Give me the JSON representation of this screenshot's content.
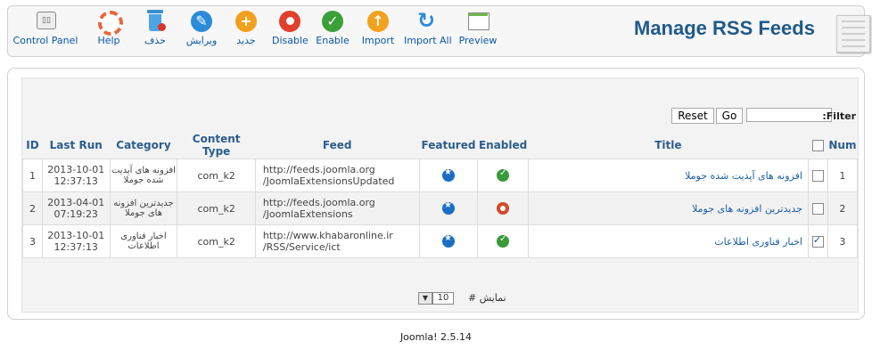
{
  "toolbar": {
    "buttons": [
      {
        "label": "Control Panel",
        "icon": "control-panel-icon"
      },
      {
        "label": "Help",
        "icon": "help-icon"
      },
      {
        "label": "حذف",
        "icon": "trash-icon"
      },
      {
        "label": "ویرایش",
        "icon": "edit-icon"
      },
      {
        "label": "جدید",
        "icon": "add-icon"
      },
      {
        "label": "Disable",
        "icon": "disable-icon"
      },
      {
        "label": "Enable",
        "icon": "enable-icon"
      },
      {
        "label": "Import",
        "icon": "import-icon"
      },
      {
        "label": "Import All",
        "icon": "import-all-icon"
      },
      {
        "label": "Preview",
        "icon": "preview-icon"
      }
    ]
  },
  "page_title": "Manage RSS Feeds",
  "filter": {
    "label": ":Filter",
    "value": "",
    "go_label": "Go",
    "reset_label": "Reset"
  },
  "table": {
    "headers": {
      "id": "ID",
      "last_run": "Last Run",
      "category": "Category",
      "content_type": "Content Type",
      "feed": "Feed",
      "featured": "Featured",
      "enabled": "Enabled",
      "title": "Title",
      "num": "Num"
    },
    "rows": [
      {
        "id": "1",
        "date": "2013-10-01",
        "time": "12:37:13",
        "category": "افزونه های آپدیت شده جوملا",
        "content_type": "com_k2",
        "feed1": "http://feeds.joomla.org",
        "feed2": "/JoomlaExtensionsUpdated",
        "featured": "yes",
        "enabled": "yes",
        "title": "افزونه های آپدیت شده جوملا",
        "checked": false,
        "num": "1"
      },
      {
        "id": "2",
        "date": "2013-04-01",
        "time": "07:19:23",
        "category": "جدیدترین افزونه های جوملا",
        "content_type": "com_k2",
        "feed1": "http://feeds.joomla.org",
        "feed2": "/JoomlaExtensions",
        "featured": "yes",
        "enabled": "no",
        "title": "جدیدترین افزونه های جوملا",
        "checked": false,
        "num": "2"
      },
      {
        "id": "3",
        "date": "2013-10-01",
        "time": "12:37:13",
        "category": "اخبار فناوری اطلاعات",
        "content_type": "com_k2",
        "feed1": "http://www.khabaronline.ir",
        "feed2": "/RSS/Service/ict",
        "featured": "yes",
        "enabled": "yes",
        "title": "اخبار فناوری اطلاعات",
        "checked": true,
        "num": "3"
      }
    ]
  },
  "pager": {
    "label": "نمایش #",
    "value": "10"
  },
  "footer": "Joomla! 2.5.14"
}
